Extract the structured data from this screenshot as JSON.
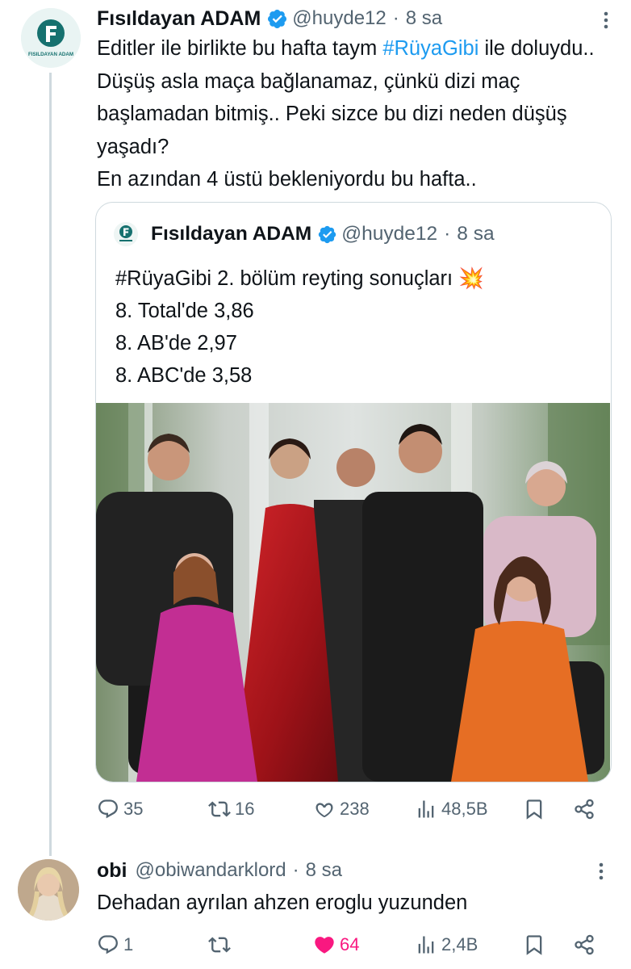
{
  "tweet": {
    "author_name": "Fısıldayan ADAM",
    "handle": "@huyde12",
    "separator": "·",
    "time": "8 sa",
    "avatar_text": "FISILDAYAN ADAM",
    "body_before": "Editler ile birlikte bu hafta taym ",
    "hashtag": "#RüyaGibi",
    "body_after": " ile doluydu.. Düşüş asla maça bağlanamaz, çünkü dizi maç başlamadan bitmiş.. Peki sizce bu dizi neden düşüş yaşadı?",
    "body_line2": "En azından 4 üstü bekleniyordu bu hafta..",
    "actions": {
      "replies": "35",
      "retweets": "16",
      "likes": "238",
      "views": "48,5B"
    }
  },
  "quote": {
    "author_name": "Fısıldayan ADAM",
    "handle": "@huyde12",
    "separator": "·",
    "time": "8 sa",
    "lines": [
      "#RüyaGibi 2. bölüm reyting sonuçları 💥",
      "8. Total'de 3,86",
      "8. AB'de 2,97",
      "8. ABC'de 3,58"
    ]
  },
  "reply": {
    "author_name": "obi",
    "handle": "@obiwandarklord",
    "separator": "·",
    "time": "8 sa",
    "body": "Dehadan ayrılan ahzen eroglu yuzunden",
    "actions": {
      "replies": "1",
      "retweets": "",
      "likes": "64",
      "views": "2,4B"
    }
  },
  "colors": {
    "text": "#0f1419",
    "secondary": "#536471",
    "link": "#1d9bf0",
    "like": "#f91880",
    "border": "#cfd9de",
    "verified": "#1d9bf0"
  },
  "icons": [
    "more-vertical-icon",
    "verified-badge-icon",
    "reply-icon",
    "retweet-icon",
    "like-icon",
    "views-icon",
    "bookmark-icon",
    "share-icon"
  ]
}
